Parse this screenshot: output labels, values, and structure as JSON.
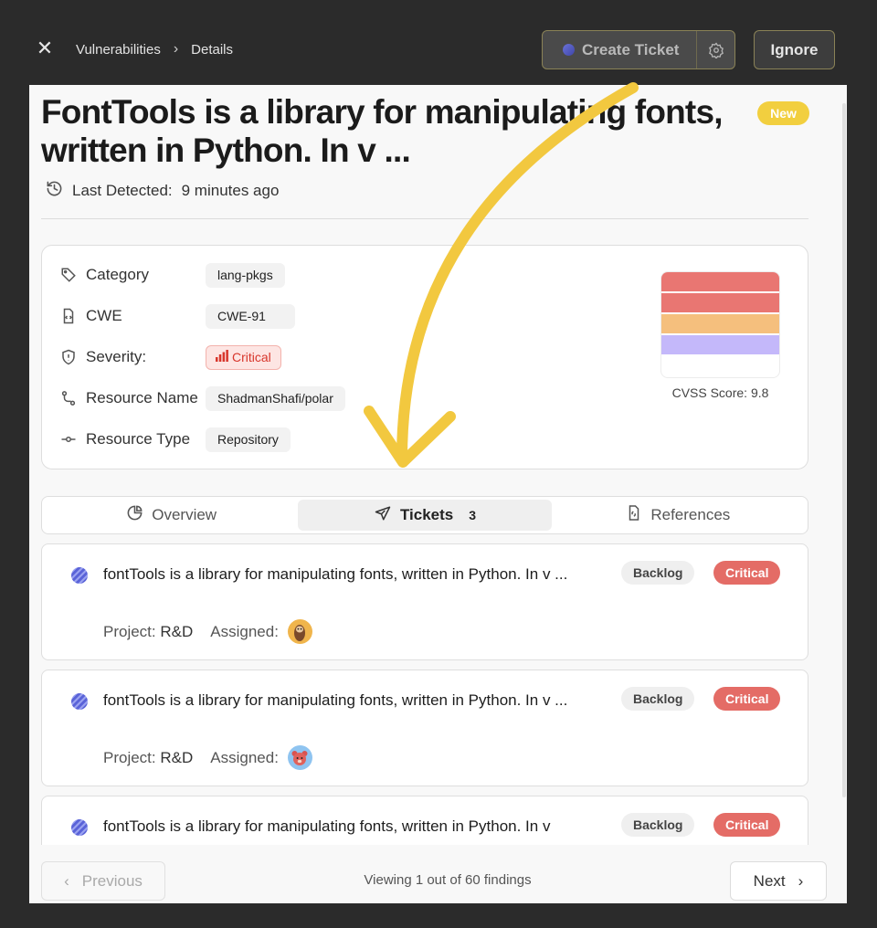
{
  "breadcrumb": {
    "items": [
      "Vulnerabilities",
      "Details"
    ]
  },
  "toolbar": {
    "create_ticket_label": "Create Ticket",
    "ignore_label": "Ignore"
  },
  "finding": {
    "title": "FontTools is a library for manipulating fonts, written in Python. In v ...",
    "status_badge": "New",
    "last_detected_label": "Last Detected:",
    "last_detected_value": "9 minutes ago"
  },
  "details": {
    "category_label": "Category",
    "category_value": "lang-pkgs",
    "cwe_label": "CWE",
    "cwe_value": "CWE-91",
    "severity_label": "Severity:",
    "severity_value": "Critical",
    "resource_name_label": "Resource Name",
    "resource_name_value": "ShadmanShafi/polar",
    "resource_type_label": "Resource Type",
    "resource_type_value": "Repository",
    "cvss_label": "CVSS Score: 9.8",
    "cvss_colors": [
      "#e97672",
      "#e97672",
      "#f5bf7d",
      "#c4b8fa"
    ]
  },
  "tabs": [
    {
      "label": "Overview",
      "icon": "pie-chart-icon"
    },
    {
      "label": "Tickets",
      "count": "3",
      "icon": "send-icon"
    },
    {
      "label": "References",
      "icon": "link-file-icon"
    }
  ],
  "tickets": [
    {
      "title": "fontTools is a library for manipulating fonts, written in Python. In v ...",
      "status": "Backlog",
      "severity": "Critical",
      "project_label": "Project:",
      "project_value": "R&D",
      "assigned_label": "Assigned:",
      "avatar": "sloth-avatar"
    },
    {
      "title": "fontTools is a library for manipulating fonts, written in Python. In v ...",
      "status": "Backlog",
      "severity": "Critical",
      "project_label": "Project:",
      "project_value": "R&D",
      "assigned_label": "Assigned:",
      "avatar": "bear-avatar"
    },
    {
      "title": "fontTools is a library for manipulating fonts, written in Python. In v",
      "status": "Backlog",
      "severity": "Critical"
    }
  ],
  "footer": {
    "previous_label": "Previous",
    "viewing_text": "Viewing 1 out of 60 findings",
    "next_label": "Next"
  }
}
